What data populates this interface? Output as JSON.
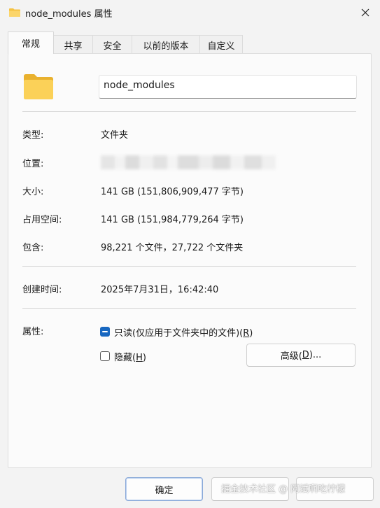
{
  "window": {
    "title": "node_modules 属性",
    "title_icon": "folder-icon",
    "close_icon": "close-icon"
  },
  "tabs": [
    {
      "label": "常规",
      "active": true
    },
    {
      "label": "共享",
      "active": false
    },
    {
      "label": "安全",
      "active": false
    },
    {
      "label": "以前的版本",
      "active": false
    },
    {
      "label": "自定义",
      "active": false
    }
  ],
  "general": {
    "folder_icon": "folder-icon",
    "name_value": "node_modules",
    "rows": [
      {
        "label": "类型:",
        "value": "文件夹"
      },
      {
        "label": "位置:",
        "value": ""
      },
      {
        "label": "大小:",
        "value": "141 GB (151,806,909,477 字节)"
      },
      {
        "label": "占用空间:",
        "value": "141 GB (151,984,779,264 字节)"
      },
      {
        "label": "包含:",
        "value": "98,221 个文件，27,722 个文件夹"
      }
    ],
    "created_label": "创建时间:",
    "created_value": "2025年7月31日，16:42:40",
    "attributes_label": "属性:",
    "readonly_label_pre": "只读(仅应用于文件夹中的文件)(",
    "readonly_label_key": "R",
    "readonly_label_post": ")",
    "readonly_state": "indeterminate",
    "hidden_label_pre": "隐藏(",
    "hidden_label_key": "H",
    "hidden_label_post": ")",
    "hidden_state": "unchecked",
    "advanced_pre": "高级(",
    "advanced_key": "D",
    "advanced_post": ")..."
  },
  "footer": {
    "ok_label": "确定",
    "watermark": "掘金技术社区 @ 阿斌啊吃柠檬"
  },
  "colors": {
    "accent": "#1867c0",
    "folder_yellow": "#f7c948"
  }
}
